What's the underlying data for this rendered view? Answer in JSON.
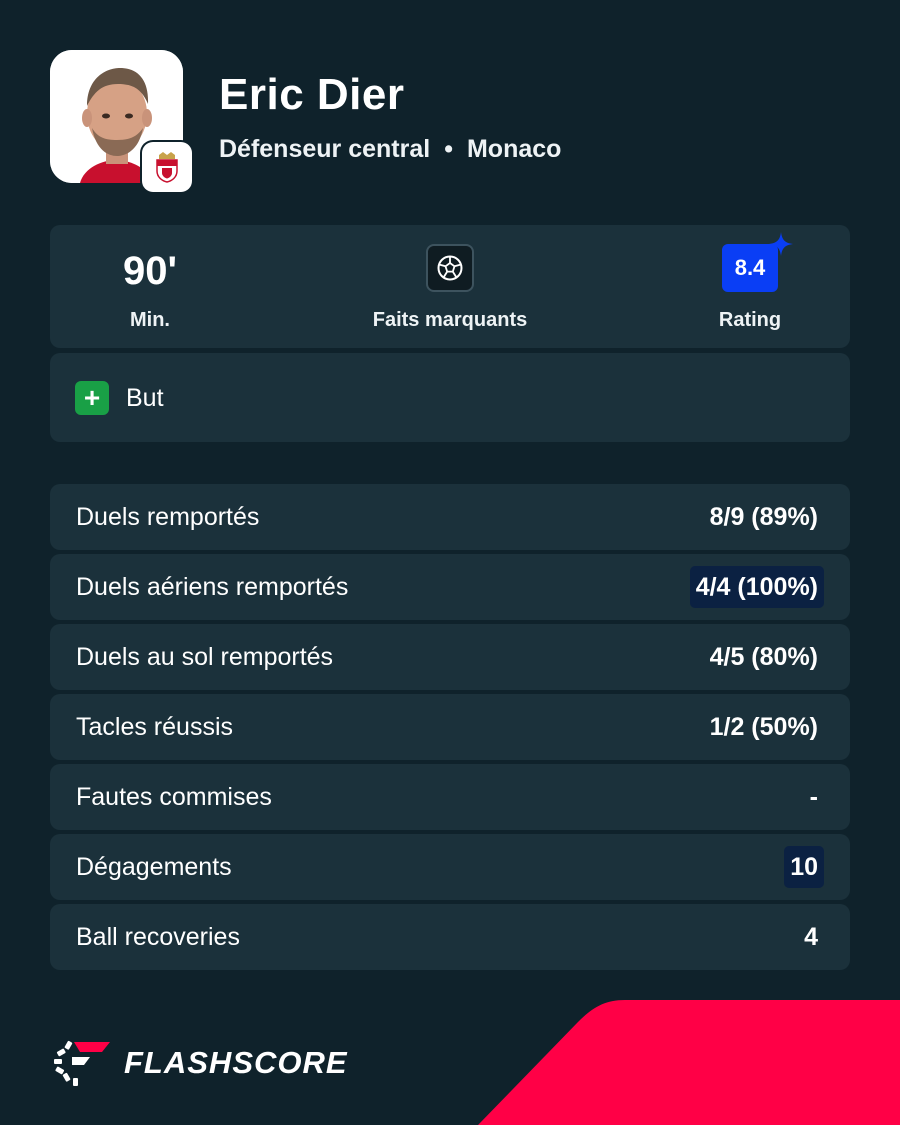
{
  "player": {
    "name": "Eric Dier",
    "position": "Défenseur central",
    "separator": "•",
    "club": "Monaco"
  },
  "summary": {
    "minutes_value": "90'",
    "minutes_label": "Min.",
    "highlights_label": "Faits marquants",
    "rating_value": "8.4",
    "rating_label": "Rating"
  },
  "events": [
    {
      "icon": "plus-icon",
      "symbol": "+",
      "label": "But"
    }
  ],
  "stats": [
    {
      "label": "Duels remportés",
      "value": "8/9 (89%)"
    },
    {
      "label": "Duels aériens remportés",
      "value": "4/4 (100%)"
    },
    {
      "label": "Duels au sol remportés",
      "value": "4/5 (80%)"
    },
    {
      "label": "Tacles réussis",
      "value": "1/2 (50%)"
    },
    {
      "label": "Fautes commises",
      "value": "-"
    },
    {
      "label": "Dégagements",
      "value": "10"
    },
    {
      "label": "Ball recoveries",
      "value": "4"
    }
  ],
  "brand": {
    "name": "FLASHSCORE"
  },
  "colors": {
    "background": "#0f222b",
    "card": "#1b313b",
    "rating": "#0a3ef5",
    "event_green": "#19a046",
    "highlight": "#0b2142",
    "accent": "#ff0046"
  }
}
